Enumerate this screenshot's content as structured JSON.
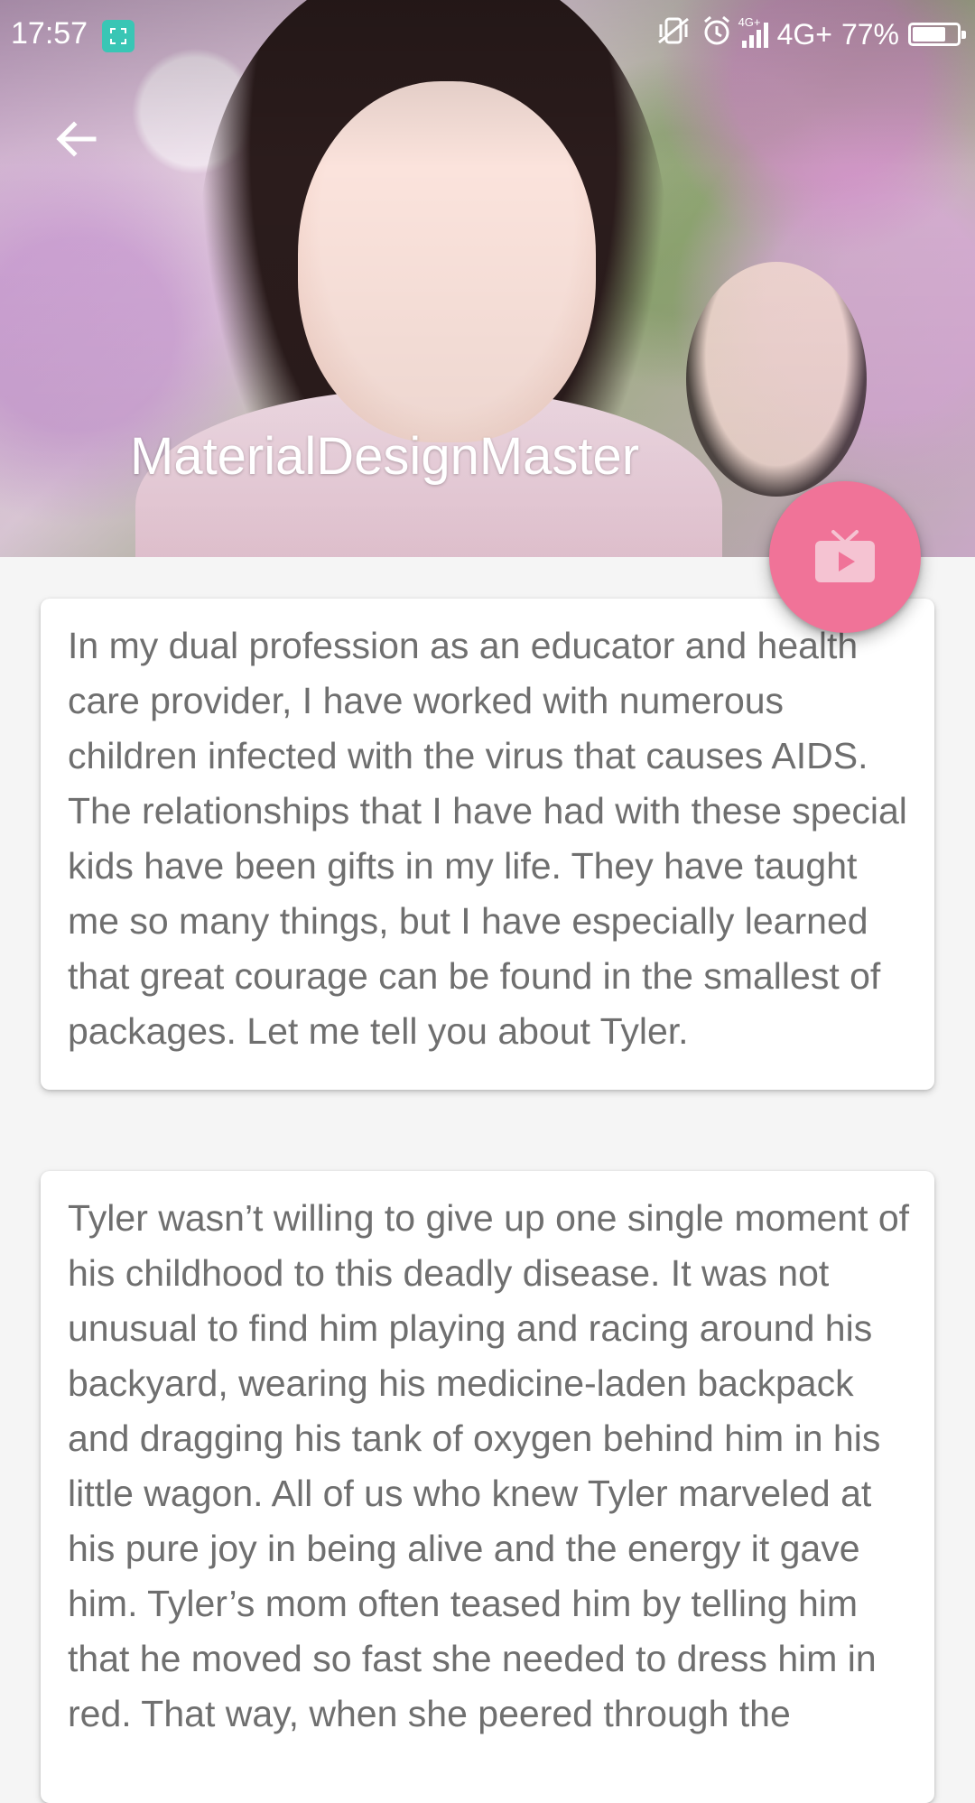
{
  "status_bar": {
    "time": "17:57",
    "network": "4G+",
    "network_small": "4G+",
    "battery_text": "77%",
    "battery_level": 0.77,
    "icons": [
      "screen-recorder-icon",
      "vibrate-off-icon",
      "alarm-icon",
      "signal-icon",
      "battery-icon"
    ]
  },
  "toolbar": {
    "title": "MaterialDesignMaster",
    "back_icon": "arrow-back-icon"
  },
  "fab": {
    "icon": "video-play-icon",
    "color": "#f07398"
  },
  "cards": [
    {
      "text": "In my dual profession as an educator and health care provider, I have worked with numerous children infected with the virus that causes AIDS. The relationships that I have had with these special kids have been gifts in my life. They have taught me so many things, but I have especially learned that great courage can be found in the smallest of packages. Let me tell you about Tyler."
    },
    {
      "text": "Tyler wasn’t willing to give up one single moment of his childhood to this deadly disease. It was not unusual to find him playing and racing around his backyard, wearing his medicine-laden backpack and dragging his tank of oxygen behind him in his little wagon. All of us who knew Tyler marveled at his pure joy in being alive and the energy it gave him. Tyler’s mom often teased him by telling him that he moved so fast she needed to dress him in red. That way, when she peered through the"
    }
  ]
}
